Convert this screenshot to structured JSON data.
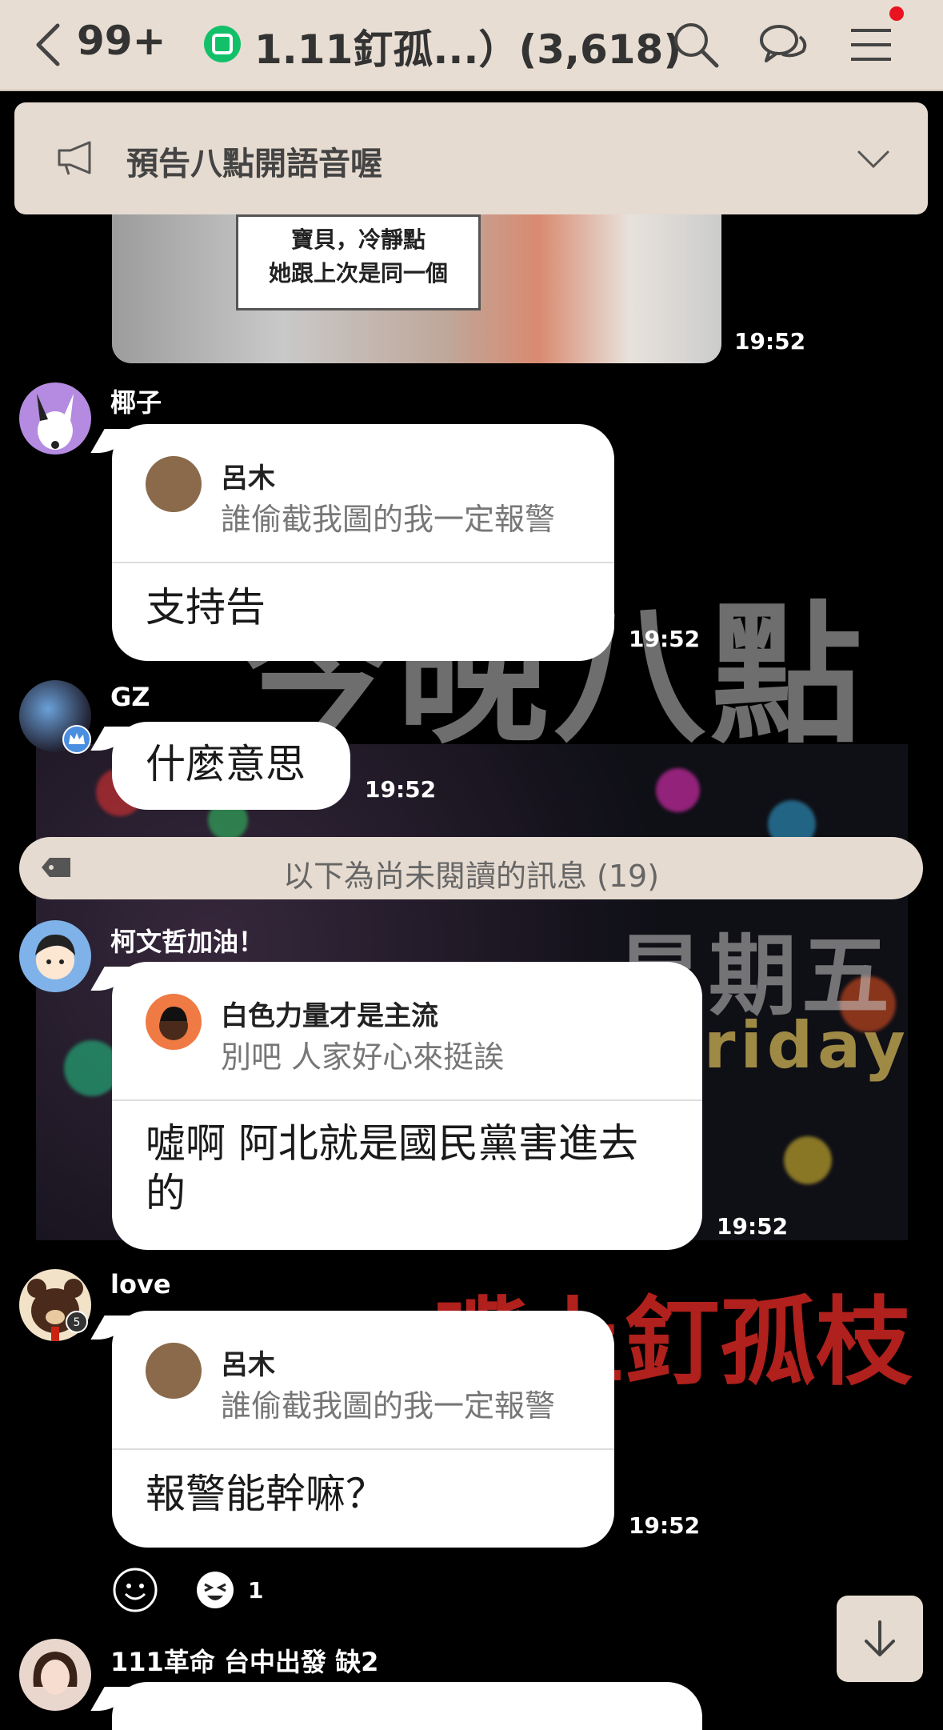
{
  "header": {
    "back_count": "99+",
    "room_title": "1.11釘孤...）(3,618)",
    "icons": [
      "back-icon",
      "search-icon",
      "chat-bubbles-icon",
      "menu-icon"
    ]
  },
  "announcement": {
    "text": "預告八點開語音喔",
    "icons": [
      "megaphone-icon",
      "chevron-down-icon"
    ]
  },
  "background_text": {
    "big_line1": "今晚八點",
    "big_line2": "星期五",
    "friday": "riday",
    "red": "嘴上釘孤枝"
  },
  "messages": [
    {
      "type": "image",
      "caption": "寶貝，冷靜點\n她跟上次是同一個",
      "time": "19:52"
    },
    {
      "sender": "椰子",
      "quote": {
        "name": "呂木",
        "text": "誰偷截我圖的我一定報警"
      },
      "text": "支持告",
      "time": "19:52"
    },
    {
      "sender": "GZ",
      "text": "什麼意思",
      "time": "19:52"
    },
    {
      "sender": "柯文哲加油！",
      "quote": {
        "name": "白色力量才是主流",
        "text": "別吧 人家好心來挺誒"
      },
      "text": "噓啊 阿北就是國民黨害進去的",
      "time": "19:52"
    },
    {
      "sender": "love",
      "quote": {
        "name": "呂木",
        "text": "誰偷截我圖的我一定報警"
      },
      "text": "報警能幹嘛？",
      "time": "19:52",
      "reaction_count": "1"
    },
    {
      "sender": "111革命 台中出發 缺2"
    }
  ],
  "unread_divider": "以下為尚未閱讀的訊息 (19)",
  "colors": {
    "header_bg": "#e8ddd2",
    "chat_bg": "#000000",
    "bubble": "#ffffff",
    "room_icon": "#13c06a",
    "notification_dot": "#e8131f"
  }
}
